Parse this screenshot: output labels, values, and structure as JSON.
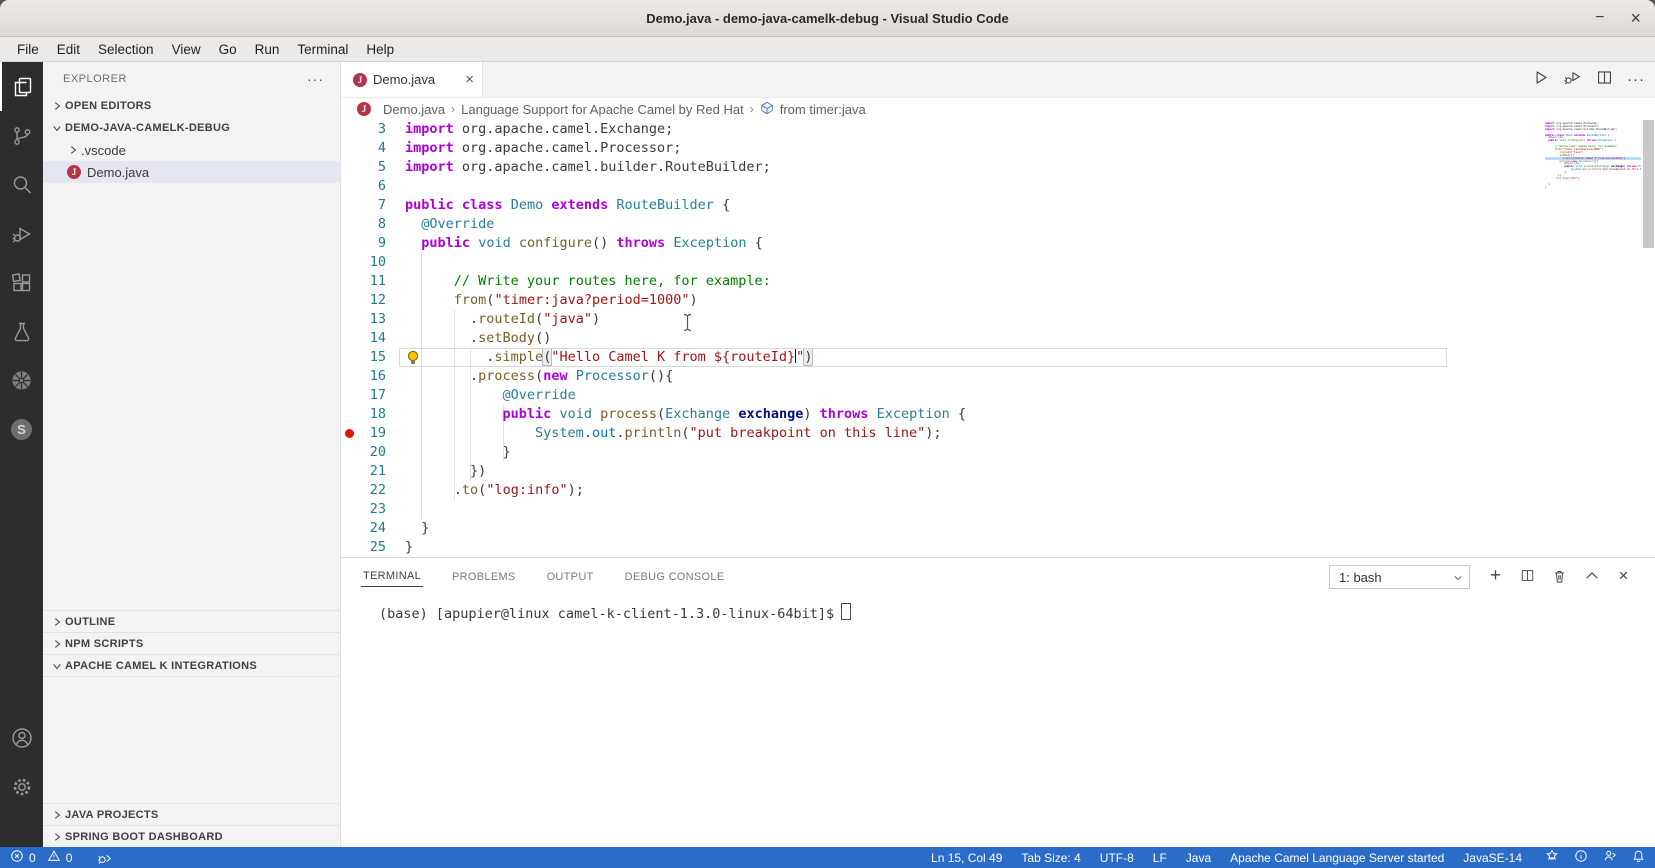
{
  "window": {
    "title": "Demo.java - demo-java-camelk-debug - Visual Studio Code",
    "minimize_glyph": "−",
    "close_glyph": "×"
  },
  "menu_bar": {
    "items": [
      "File",
      "Edit",
      "Selection",
      "View",
      "Go",
      "Run",
      "Terminal",
      "Help"
    ]
  },
  "activity_bar": {
    "icons": [
      "explorer",
      "source-control",
      "search",
      "run-and-debug",
      "extensions",
      "testing",
      "kubernetes",
      "spring-boot"
    ],
    "bottom_icons": [
      "accounts",
      "settings"
    ],
    "spring_letter": "S"
  },
  "sidebar": {
    "title": "EXPLORER",
    "more_actions": "···",
    "open_editors_label": "OPEN EDITORS",
    "project_label": "DEMO-JAVA-CAMELK-DEBUG",
    "vscode_folder_label": ".vscode",
    "java_file_label": "Demo.java",
    "java_icon_letter": "J",
    "outline_label": "OUTLINE",
    "npm_label": "NPM SCRIPTS",
    "camelk_label": "APACHE CAMEL K INTEGRATIONS",
    "java_projects_label": "JAVA PROJECTS",
    "spring_boot_label": "SPRING BOOT DASHBOARD"
  },
  "editor": {
    "tab": {
      "label": "Demo.java",
      "close_glyph": "×"
    },
    "actions_more_glyph": "···",
    "breadcrumb": {
      "file": "Demo.java",
      "separator": "›",
      "extension": "Language Support for Apache Camel by Red Hat",
      "symbol": "from timer:java"
    },
    "code": {
      "lines": [
        {
          "n": 3,
          "t": [
            [
              "kw",
              "import"
            ],
            [
              "pl",
              " org.apache.camel.Exchange;"
            ]
          ]
        },
        {
          "n": 4,
          "t": [
            [
              "kw",
              "import"
            ],
            [
              "pl",
              " org.apache.camel.Processor;"
            ]
          ]
        },
        {
          "n": 5,
          "t": [
            [
              "kw",
              "import"
            ],
            [
              "pl",
              " org.apache.camel.builder.RouteBuilder;"
            ]
          ]
        },
        {
          "n": 6,
          "t": []
        },
        {
          "n": 7,
          "t": [
            [
              "kw",
              "public"
            ],
            [
              "pl",
              " "
            ],
            [
              "kw",
              "class"
            ],
            [
              "pl",
              " "
            ],
            [
              "ty",
              "Demo"
            ],
            [
              "pl",
              " "
            ],
            [
              "kw",
              "extends"
            ],
            [
              "pl",
              " "
            ],
            [
              "ty",
              "RouteBuilder"
            ],
            [
              "pl",
              " {"
            ]
          ]
        },
        {
          "n": 8,
          "t": [
            [
              "pl",
              "  "
            ],
            [
              "ty",
              "@Override"
            ]
          ]
        },
        {
          "n": 9,
          "t": [
            [
              "pl",
              "  "
            ],
            [
              "kw",
              "public"
            ],
            [
              "pl",
              " "
            ],
            [
              "ty",
              "void"
            ],
            [
              "pl",
              " "
            ],
            [
              "fn",
              "configure"
            ],
            [
              "pl",
              "() "
            ],
            [
              "kw",
              "throws"
            ],
            [
              "pl",
              " "
            ],
            [
              "ty",
              "Exception"
            ],
            [
              "pl",
              " {"
            ]
          ]
        },
        {
          "n": 10,
          "t": []
        },
        {
          "n": 11,
          "t": [
            [
              "pl",
              "      "
            ],
            [
              "cm",
              "// Write your routes here, for example:"
            ]
          ]
        },
        {
          "n": 12,
          "t": [
            [
              "pl",
              "      "
            ],
            [
              "fn",
              "from"
            ],
            [
              "pl",
              "("
            ],
            [
              "str",
              "\"timer:java?period=1000\""
            ],
            [
              "pl",
              ")"
            ]
          ]
        },
        {
          "n": 13,
          "t": [
            [
              "pl",
              "        ."
            ],
            [
              "fn",
              "routeId"
            ],
            [
              "pl",
              "("
            ],
            [
              "str",
              "\"java\""
            ],
            [
              "pl",
              ")"
            ]
          ]
        },
        {
          "n": 14,
          "t": [
            [
              "pl",
              "        ."
            ],
            [
              "fn",
              "setBody"
            ],
            [
              "pl",
              "()"
            ]
          ]
        },
        {
          "n": 15,
          "hl": true,
          "bulb": true,
          "t": [
            [
              "pl",
              "          ."
            ],
            [
              "fn",
              "simple"
            ],
            [
              "bm",
              "("
            ],
            [
              "str",
              "\"Hello Camel K from ${routeId}"
            ],
            [
              "cur",
              ""
            ],
            [
              "str",
              "\""
            ],
            [
              "bm",
              ")"
            ]
          ]
        },
        {
          "n": 16,
          "t": [
            [
              "pl",
              "        ."
            ],
            [
              "fn",
              "process"
            ],
            [
              "pl",
              "("
            ],
            [
              "kw",
              "new"
            ],
            [
              "pl",
              " "
            ],
            [
              "ty",
              "Processor"
            ],
            [
              "pl",
              "(){"
            ]
          ]
        },
        {
          "n": 17,
          "t": [
            [
              "pl",
              "            "
            ],
            [
              "ty",
              "@Override"
            ]
          ]
        },
        {
          "n": 18,
          "t": [
            [
              "pl",
              "            "
            ],
            [
              "kw",
              "public"
            ],
            [
              "pl",
              " "
            ],
            [
              "ty",
              "void"
            ],
            [
              "pl",
              " "
            ],
            [
              "fn",
              "process"
            ],
            [
              "pl",
              "("
            ],
            [
              "ty",
              "Exchange"
            ],
            [
              "pl",
              " "
            ],
            [
              "var",
              "exchange"
            ],
            [
              "pl",
              ") "
            ],
            [
              "kw",
              "throws"
            ],
            [
              "pl",
              " "
            ],
            [
              "ty",
              "Exception"
            ],
            [
              "pl",
              " {"
            ]
          ]
        },
        {
          "n": 19,
          "bp": true,
          "t": [
            [
              "pl",
              "                "
            ],
            [
              "ty",
              "System"
            ],
            [
              "pl",
              "."
            ],
            [
              "fld",
              "out"
            ],
            [
              "pl",
              "."
            ],
            [
              "fn",
              "println"
            ],
            [
              "pl",
              "("
            ],
            [
              "str",
              "\"put breakpoint on this line\""
            ],
            [
              "pl",
              ");"
            ]
          ]
        },
        {
          "n": 20,
          "t": [
            [
              "pl",
              "            }"
            ]
          ]
        },
        {
          "n": 21,
          "t": [
            [
              "pl",
              "        })"
            ]
          ]
        },
        {
          "n": 22,
          "t": [
            [
              "pl",
              "      ."
            ],
            [
              "fn",
              "to"
            ],
            [
              "pl",
              "("
            ],
            [
              "str",
              "\"log:info\""
            ],
            [
              "pl",
              ");"
            ]
          ]
        },
        {
          "n": 23,
          "t": []
        },
        {
          "n": 24,
          "t": [
            [
              "pl",
              "  }"
            ]
          ]
        },
        {
          "n": 25,
          "t": [
            [
              "pl",
              "}"
            ]
          ]
        }
      ]
    }
  },
  "panel": {
    "tabs": [
      {
        "label": "TERMINAL",
        "active": true
      },
      {
        "label": "PROBLEMS",
        "active": false
      },
      {
        "label": "OUTPUT",
        "active": false
      },
      {
        "label": "DEBUG CONSOLE",
        "active": false
      }
    ],
    "shell_selector_value": "1: bash",
    "terminal_prompt": "(base) [apupier@linux camel-k-client-1.3.0-linux-64bit]$",
    "plus_glyph": "+",
    "close_glyph": "×"
  },
  "status_bar": {
    "errors": "0",
    "warnings": "0",
    "right_items": [
      "Ln 15, Col 49",
      "Tab Size: 4",
      "UTF-8",
      "LF",
      "Java",
      "Apache Camel Language Server started",
      "JavaSE-14"
    ],
    "background": "#2a6cc8"
  },
  "colors": {
    "keyword": "#af00db",
    "type": "#267f99",
    "function": "#795e26",
    "string": "#a31515",
    "comment": "#008000",
    "field": "#0070c1",
    "variable": "#001080",
    "line_number": "#237893",
    "breakpoint": "#e51400",
    "lightbulb": "#fdc500",
    "selected_row": "#e4e6f1",
    "activity_bar": "#2d2d2d"
  }
}
